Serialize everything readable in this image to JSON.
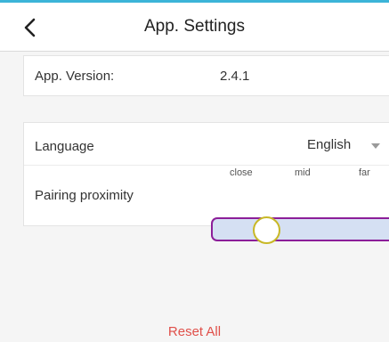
{
  "header": {
    "title": "App. Settings",
    "back_icon": "chevron-left-icon"
  },
  "version": {
    "label": "App. Version:",
    "value": "2.4.1"
  },
  "language": {
    "label": "Language",
    "value": "English",
    "dropdown_icon": "triangle-down-icon"
  },
  "proximity": {
    "label": "Pairing proximity",
    "ticks": [
      "close",
      "mid",
      "far"
    ],
    "level": 0.35,
    "colors": {
      "track_fill": "#d5e0f3",
      "track_border": "#8c1e99",
      "knob_border": "#c8b826"
    }
  },
  "footer": {
    "reset_label": "Reset All",
    "reset_color": "#e0504a"
  },
  "accent": "#3cb4d8"
}
